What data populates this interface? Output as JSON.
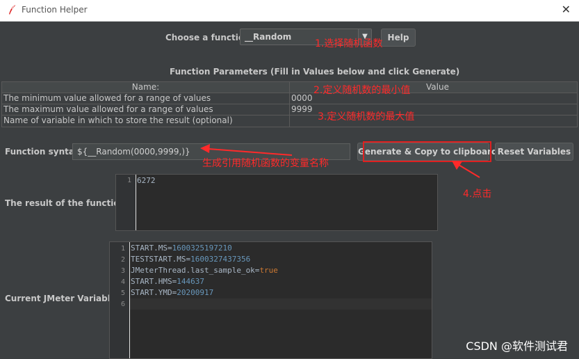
{
  "window": {
    "title": "Function Helper",
    "app_icon": "feather-icon",
    "close_icon": "close-icon"
  },
  "choose": {
    "label": "Choose a function",
    "selected": "__Random",
    "help_label": "Help"
  },
  "params": {
    "heading": "Function Parameters (Fill in Values below and click Generate)",
    "columns": [
      "Name:",
      "Value"
    ],
    "rows": [
      {
        "name": "The minimum value allowed for a range of values",
        "value": "0000"
      },
      {
        "name": "The maximum value allowed for a range of values",
        "value": "9999"
      },
      {
        "name": "Name of variable in which to store the result (optional)",
        "value": ""
      }
    ]
  },
  "syntax": {
    "label": "Function syntax:",
    "value": "${__Random(0000,9999,)}"
  },
  "buttons": {
    "generate": "Generate & Copy to clipboard",
    "reset": "Reset Variables"
  },
  "result": {
    "label": "The result of the function is",
    "line_number": "1",
    "value": "6272"
  },
  "variables": {
    "label": "Current JMeter Variables",
    "lines": [
      {
        "n": "1",
        "key": "START.MS=",
        "val": "1600325197210"
      },
      {
        "n": "2",
        "key": "TESTSTART.MS=",
        "val": "1600327437356"
      },
      {
        "n": "3",
        "key": "JMeterThread.last_sample_ok=",
        "val": "true"
      },
      {
        "n": "4",
        "key": "START.HMS=",
        "val": "144637"
      },
      {
        "n": "5",
        "key": "START.YMD=",
        "val": "20200917"
      },
      {
        "n": "6",
        "key": "",
        "val": ""
      }
    ]
  },
  "annotations": {
    "a1": "1.选择随机函数",
    "a2": "2.定义随机数的最小值",
    "a3": "3.定义随机数的最大值",
    "a4": "生成引用随机函数的变量名称",
    "a5": "4.点击"
  },
  "watermark": "CSDN @软件测试君",
  "colors": {
    "background": "#3c3f41",
    "annotation": "#ff2a2a",
    "number": "#6897bb",
    "keyword": "#cc7832"
  }
}
